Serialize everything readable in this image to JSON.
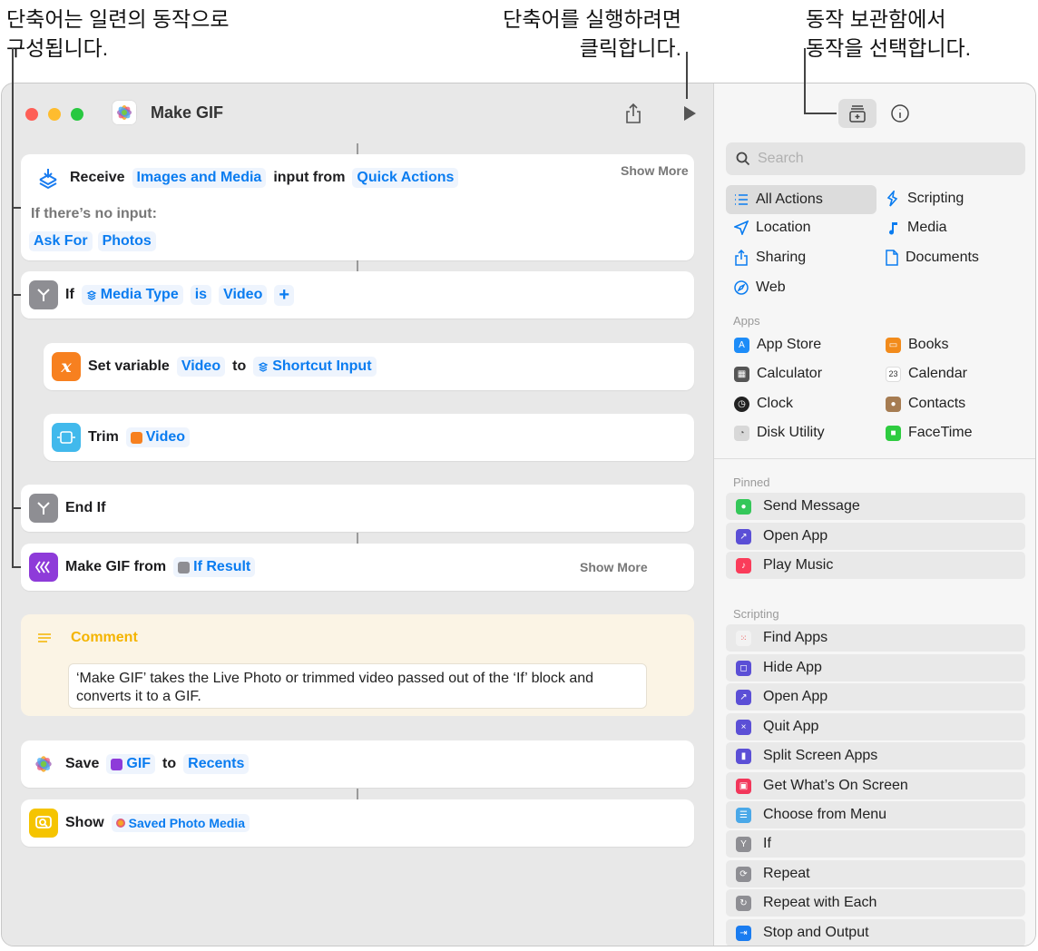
{
  "callouts": {
    "left": {
      "line1": "단축어는 일련의 동작으로",
      "line2": "구성됩니다."
    },
    "middle": {
      "line1": "단축어를 실행하려면",
      "line2": "클릭합니다."
    },
    "right": {
      "line1": "동작 보관함에서",
      "line2": "동작을 선택합니다."
    }
  },
  "window": {
    "title": "Make GIF",
    "app_icon": "photos-icon",
    "toolbar": {
      "share_icon": "share-icon",
      "run_icon": "play-icon",
      "library_icon": "action-library-icon",
      "info_icon": "info-icon"
    }
  },
  "editor": {
    "receive": {
      "label": "Receive",
      "token_type": "Images and Media",
      "mid": "input from",
      "token_source": "Quick Actions",
      "show_more": "Show More",
      "no_input_label": "If there’s no input:",
      "ask_for": "Ask For",
      "photos": "Photos"
    },
    "if": {
      "label": "If",
      "var": "Media Type",
      "op": "is",
      "value": "Video",
      "add": "+"
    },
    "set_variable": {
      "label": "Set variable",
      "name": "Video",
      "to": "to",
      "value": "Shortcut Input"
    },
    "trim": {
      "label": "Trim",
      "value": "Video"
    },
    "end_if": {
      "label": "End If"
    },
    "make_gif": {
      "label": "Make GIF from",
      "value": "If Result",
      "show_more": "Show More"
    },
    "comment": {
      "title": "Comment",
      "text": "‘Make GIF’ takes the Live Photo or trimmed video passed out of the ‘If’ block and converts it to a GIF."
    },
    "save": {
      "label": "Save",
      "value": "GIF",
      "to": "to",
      "dest": "Recents"
    },
    "show": {
      "label": "Show",
      "value": "Saved Photo Media"
    }
  },
  "sidebar": {
    "search_placeholder": "Search",
    "categories": {
      "all_actions": "All Actions",
      "scripting": "Scripting",
      "location": "Location",
      "media": "Media",
      "sharing": "Sharing",
      "documents": "Documents",
      "web": "Web"
    },
    "apps_header": "Apps",
    "apps": {
      "app_store": "App Store",
      "books": "Books",
      "calculator": "Calculator",
      "calendar": "Calendar",
      "clock": "Clock",
      "contacts": "Contacts",
      "disk_utility": "Disk Utility",
      "facetime": "FaceTime",
      "calendar_day": "23"
    },
    "pinned_header": "Pinned",
    "pinned": [
      "Send Message",
      "Open App",
      "Play Music"
    ],
    "scripting_header": "Scripting",
    "scripting": [
      "Find Apps",
      "Hide App",
      "Open App",
      "Quit App",
      "Split Screen Apps",
      "Get What’s On Screen",
      "Choose from Menu",
      "If",
      "Repeat",
      "Repeat with Each",
      "Stop and Output"
    ]
  },
  "colors": {
    "accent": "#0a7cf0",
    "comment": "#f4b400",
    "close": "#fe5f57",
    "minimize": "#febc2e",
    "zoom": "#28c840"
  }
}
